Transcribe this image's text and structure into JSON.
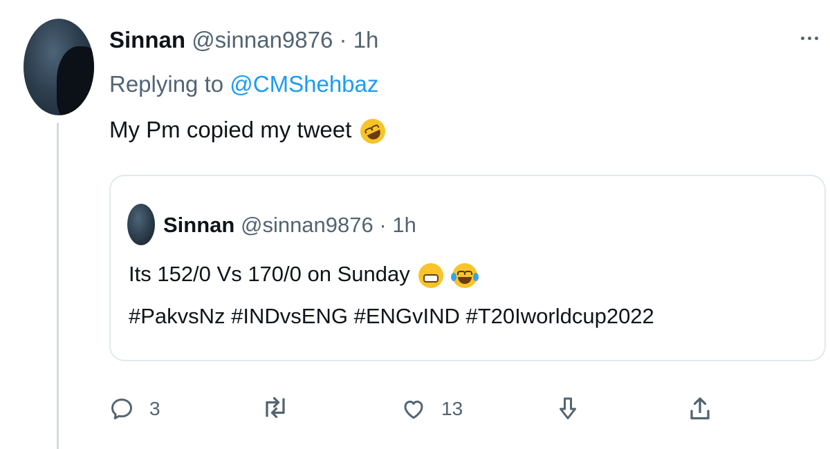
{
  "tweet": {
    "author_name": "Sinnan",
    "handle": "@sinnan9876",
    "separator": "·",
    "time": "1h",
    "replying_prefix": "Replying to",
    "replying_to": "@CMShehbaz",
    "text": "My Pm copied my tweet",
    "text_emoji": "rolling-on-floor-laughing-icon"
  },
  "quoted_tweet": {
    "author_name": "Sinnan",
    "handle": "@sinnan9876",
    "separator": "·",
    "time": "1h",
    "text": "Its 152/0 Vs 170/0 on Sunday",
    "emojis": [
      "grimacing-face-icon",
      "laughing-tears-icon"
    ],
    "hashtags": "#PakvsNz #INDvsENG #ENGvIND #T20Iworldcup2022"
  },
  "actions": {
    "reply_count": "3",
    "retweet_count": "",
    "like_count": "13"
  },
  "colors": {
    "link": "#1d9bf0",
    "secondary_text": "#536471",
    "border": "#e1e8ed",
    "thread_line": "#cfd9de"
  }
}
